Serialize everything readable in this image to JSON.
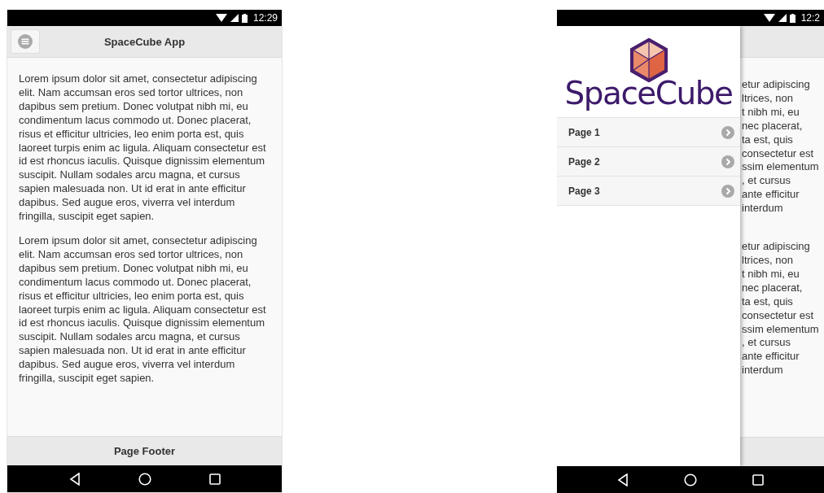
{
  "phones": [
    {
      "status_bar": {
        "time": "12:29"
      },
      "header": {
        "title": "SpaceCube App"
      },
      "content": {
        "paragraphs": [
          "Lorem ipsum dolor sit amet, consectetur adipiscing elit. Nam accumsan eros sed tortor ultrices, non dapibus sem pretium. Donec volutpat nibh mi, eu condimentum lacus commodo ut. Donec placerat, risus et efficitur ultricies, leo enim porta est, quis laoreet turpis enim ac ligula. Aliquam consectetur est id est rhoncus iaculis. Quisque dignissim elementum suscipit. Nullam sodales arcu magna, et cursus sapien malesuada non. Ut id erat in ante efficitur dapibus. Sed augue eros, viverra vel interdum fringilla, suscipit eget sapien.",
          "Lorem ipsum dolor sit amet, consectetur adipiscing elit. Nam accumsan eros sed tortor ultrices, non dapibus sem pretium. Donec volutpat nibh mi, eu condimentum lacus commodo ut. Donec placerat, risus et efficitur ultricies, leo enim porta est, quis laoreet turpis enim ac ligula. Aliquam consectetur est id est rhoncus iaculis. Quisque dignissim elementum suscipit. Nullam sodales arcu magna, et cursus sapien malesuada non. Ut id erat in ante efficitur dapibus. Sed augue eros, viverra vel interdum fringilla, suscipit eget sapien."
        ]
      },
      "footer": {
        "text": "Page Footer"
      }
    },
    {
      "status_bar": {
        "time": "12:2"
      },
      "drawer": {
        "logo_text": "SpaceCube",
        "items": [
          {
            "label": "Page 1"
          },
          {
            "label": "Page 2"
          },
          {
            "label": "Page 3"
          }
        ]
      },
      "content": {
        "visible_lines": [
          [
            "etur adipiscing",
            "ltrices, non",
            "t nibh mi, eu",
            "nec placerat,",
            "ta est, quis",
            "consectetur est",
            "ssim elementum",
            ", et cursus",
            "ante efficitur",
            "interdum"
          ],
          [
            "etur adipiscing",
            "ltrices, non",
            "t nibh mi, eu",
            "nec placerat,",
            "ta est, quis",
            "consectetur est",
            "ssim elementum",
            ", et cursus",
            "ante efficitur",
            "interdum"
          ]
        ]
      }
    }
  ]
}
